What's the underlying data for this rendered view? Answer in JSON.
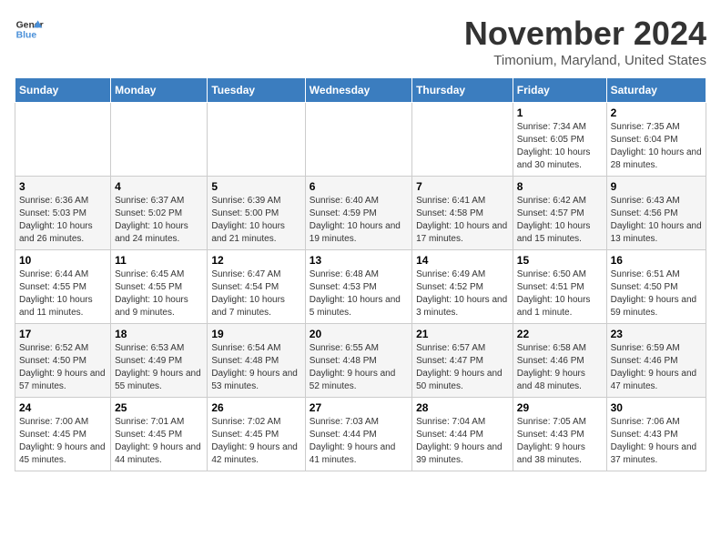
{
  "logo": {
    "line1": "General",
    "line2": "Blue"
  },
  "title": "November 2024",
  "subtitle": "Timonium, Maryland, United States",
  "headers": [
    "Sunday",
    "Monday",
    "Tuesday",
    "Wednesday",
    "Thursday",
    "Friday",
    "Saturday"
  ],
  "weeks": [
    [
      {
        "day": "",
        "info": ""
      },
      {
        "day": "",
        "info": ""
      },
      {
        "day": "",
        "info": ""
      },
      {
        "day": "",
        "info": ""
      },
      {
        "day": "",
        "info": ""
      },
      {
        "day": "1",
        "info": "Sunrise: 7:34 AM\nSunset: 6:05 PM\nDaylight: 10 hours and 30 minutes."
      },
      {
        "day": "2",
        "info": "Sunrise: 7:35 AM\nSunset: 6:04 PM\nDaylight: 10 hours and 28 minutes."
      }
    ],
    [
      {
        "day": "3",
        "info": "Sunrise: 6:36 AM\nSunset: 5:03 PM\nDaylight: 10 hours and 26 minutes."
      },
      {
        "day": "4",
        "info": "Sunrise: 6:37 AM\nSunset: 5:02 PM\nDaylight: 10 hours and 24 minutes."
      },
      {
        "day": "5",
        "info": "Sunrise: 6:39 AM\nSunset: 5:00 PM\nDaylight: 10 hours and 21 minutes."
      },
      {
        "day": "6",
        "info": "Sunrise: 6:40 AM\nSunset: 4:59 PM\nDaylight: 10 hours and 19 minutes."
      },
      {
        "day": "7",
        "info": "Sunrise: 6:41 AM\nSunset: 4:58 PM\nDaylight: 10 hours and 17 minutes."
      },
      {
        "day": "8",
        "info": "Sunrise: 6:42 AM\nSunset: 4:57 PM\nDaylight: 10 hours and 15 minutes."
      },
      {
        "day": "9",
        "info": "Sunrise: 6:43 AM\nSunset: 4:56 PM\nDaylight: 10 hours and 13 minutes."
      }
    ],
    [
      {
        "day": "10",
        "info": "Sunrise: 6:44 AM\nSunset: 4:55 PM\nDaylight: 10 hours and 11 minutes."
      },
      {
        "day": "11",
        "info": "Sunrise: 6:45 AM\nSunset: 4:55 PM\nDaylight: 10 hours and 9 minutes."
      },
      {
        "day": "12",
        "info": "Sunrise: 6:47 AM\nSunset: 4:54 PM\nDaylight: 10 hours and 7 minutes."
      },
      {
        "day": "13",
        "info": "Sunrise: 6:48 AM\nSunset: 4:53 PM\nDaylight: 10 hours and 5 minutes."
      },
      {
        "day": "14",
        "info": "Sunrise: 6:49 AM\nSunset: 4:52 PM\nDaylight: 10 hours and 3 minutes."
      },
      {
        "day": "15",
        "info": "Sunrise: 6:50 AM\nSunset: 4:51 PM\nDaylight: 10 hours and 1 minute."
      },
      {
        "day": "16",
        "info": "Sunrise: 6:51 AM\nSunset: 4:50 PM\nDaylight: 9 hours and 59 minutes."
      }
    ],
    [
      {
        "day": "17",
        "info": "Sunrise: 6:52 AM\nSunset: 4:50 PM\nDaylight: 9 hours and 57 minutes."
      },
      {
        "day": "18",
        "info": "Sunrise: 6:53 AM\nSunset: 4:49 PM\nDaylight: 9 hours and 55 minutes."
      },
      {
        "day": "19",
        "info": "Sunrise: 6:54 AM\nSunset: 4:48 PM\nDaylight: 9 hours and 53 minutes."
      },
      {
        "day": "20",
        "info": "Sunrise: 6:55 AM\nSunset: 4:48 PM\nDaylight: 9 hours and 52 minutes."
      },
      {
        "day": "21",
        "info": "Sunrise: 6:57 AM\nSunset: 4:47 PM\nDaylight: 9 hours and 50 minutes."
      },
      {
        "day": "22",
        "info": "Sunrise: 6:58 AM\nSunset: 4:46 PM\nDaylight: 9 hours and 48 minutes."
      },
      {
        "day": "23",
        "info": "Sunrise: 6:59 AM\nSunset: 4:46 PM\nDaylight: 9 hours and 47 minutes."
      }
    ],
    [
      {
        "day": "24",
        "info": "Sunrise: 7:00 AM\nSunset: 4:45 PM\nDaylight: 9 hours and 45 minutes."
      },
      {
        "day": "25",
        "info": "Sunrise: 7:01 AM\nSunset: 4:45 PM\nDaylight: 9 hours and 44 minutes."
      },
      {
        "day": "26",
        "info": "Sunrise: 7:02 AM\nSunset: 4:45 PM\nDaylight: 9 hours and 42 minutes."
      },
      {
        "day": "27",
        "info": "Sunrise: 7:03 AM\nSunset: 4:44 PM\nDaylight: 9 hours and 41 minutes."
      },
      {
        "day": "28",
        "info": "Sunrise: 7:04 AM\nSunset: 4:44 PM\nDaylight: 9 hours and 39 minutes."
      },
      {
        "day": "29",
        "info": "Sunrise: 7:05 AM\nSunset: 4:43 PM\nDaylight: 9 hours and 38 minutes."
      },
      {
        "day": "30",
        "info": "Sunrise: 7:06 AM\nSunset: 4:43 PM\nDaylight: 9 hours and 37 minutes."
      }
    ]
  ]
}
